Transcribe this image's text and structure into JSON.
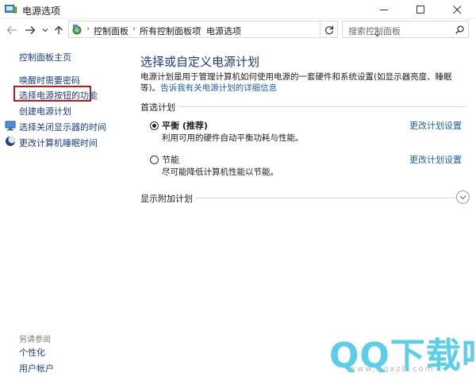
{
  "window": {
    "title": "电源选项"
  },
  "address": {
    "crumbs": [
      "控制面板",
      "所有控制面板项",
      "电源选项"
    ],
    "search_placeholder": "搜索控制面板"
  },
  "sidebar": {
    "home": "控制面板主页",
    "items": [
      {
        "label": "唤醒时需要密码"
      },
      {
        "label": "选择电源按钮的功能"
      },
      {
        "label": "创建电源计划"
      },
      {
        "label": "选择关闭显示器的时间"
      },
      {
        "label": "更改计算机睡眠时间"
      }
    ],
    "see_also": "另请参阅",
    "see_also_items": [
      "个性化",
      "用户帐户"
    ]
  },
  "main": {
    "heading": "选择或自定义电源计划",
    "desc_part1": "电源计划是用于管理计算机如何使用电源的一套硬件和系统设置(如显示器亮度、睡眠等)。",
    "desc_link": "告诉我有关电源计划的详细信息",
    "preferred_label": "首选计划",
    "plans": [
      {
        "name": "平衡 (推荐)",
        "desc": "利用可用的硬件自动平衡功耗与性能。",
        "link": "更改计划设置",
        "selected": true
      },
      {
        "name": "节能",
        "desc": "尽可能降低计算机性能以节能。",
        "link": "更改计划设置",
        "selected": false
      }
    ],
    "more_plans_label": "显示附加计划"
  },
  "watermark": {
    "logo": "QQ下载吧",
    "url": "www.qqxzb.com"
  },
  "colors": {
    "link": "#1e5fb4",
    "heading": "#1e3a8a",
    "highlight": "#b31e23",
    "watermark": "#3fc6e6"
  }
}
